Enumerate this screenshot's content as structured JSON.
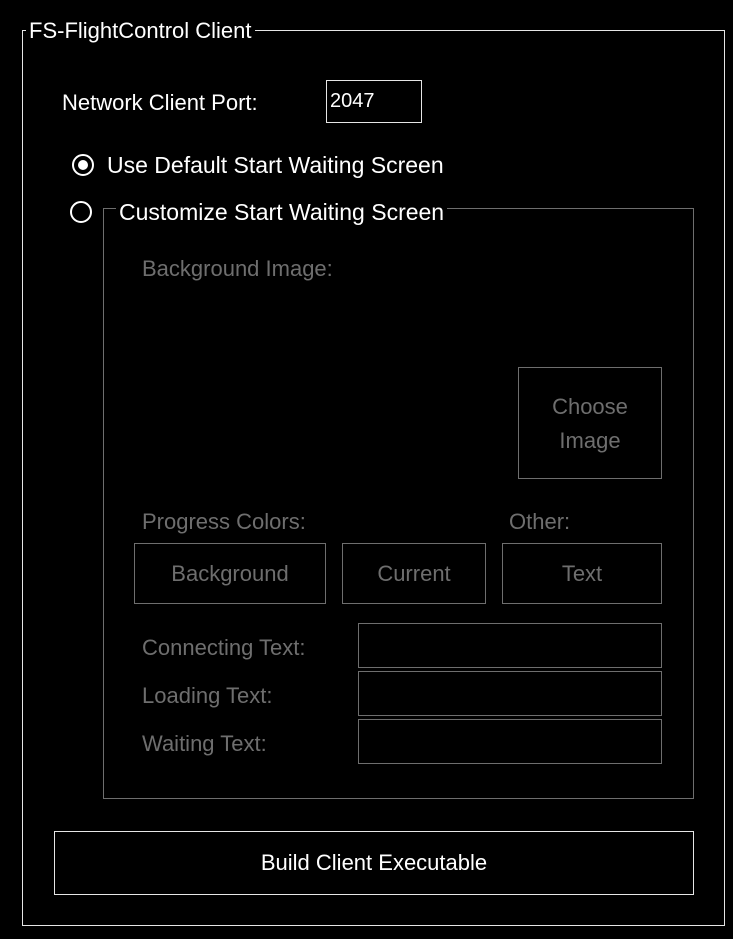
{
  "group": {
    "title": "FS-FlightControl Client"
  },
  "network": {
    "port_label": "Network Client Port:",
    "port_value": "2047"
  },
  "options": {
    "default_label": "Use Default Start Waiting Screen",
    "default_selected": true,
    "custom_label": "Customize Start Waiting Screen",
    "custom_selected": false
  },
  "custom": {
    "background_image_label": "Background Image:",
    "choose_image_line1": "Choose",
    "choose_image_line2": "Image",
    "progress_colors_label": "Progress Colors:",
    "other_label": "Other:",
    "background_button": "Background",
    "current_button": "Current",
    "text_button": "Text",
    "connecting_text_label": "Connecting Text:",
    "connecting_text_value": "",
    "loading_text_label": "Loading Text:",
    "loading_text_value": "",
    "waiting_text_label": "Waiting Text:",
    "waiting_text_value": ""
  },
  "build_button": "Build Client Executable",
  "colors": {
    "background": "#000000",
    "text": "#ffffff",
    "border": "#e6e6e6",
    "disabled": "#6e6e6e"
  }
}
